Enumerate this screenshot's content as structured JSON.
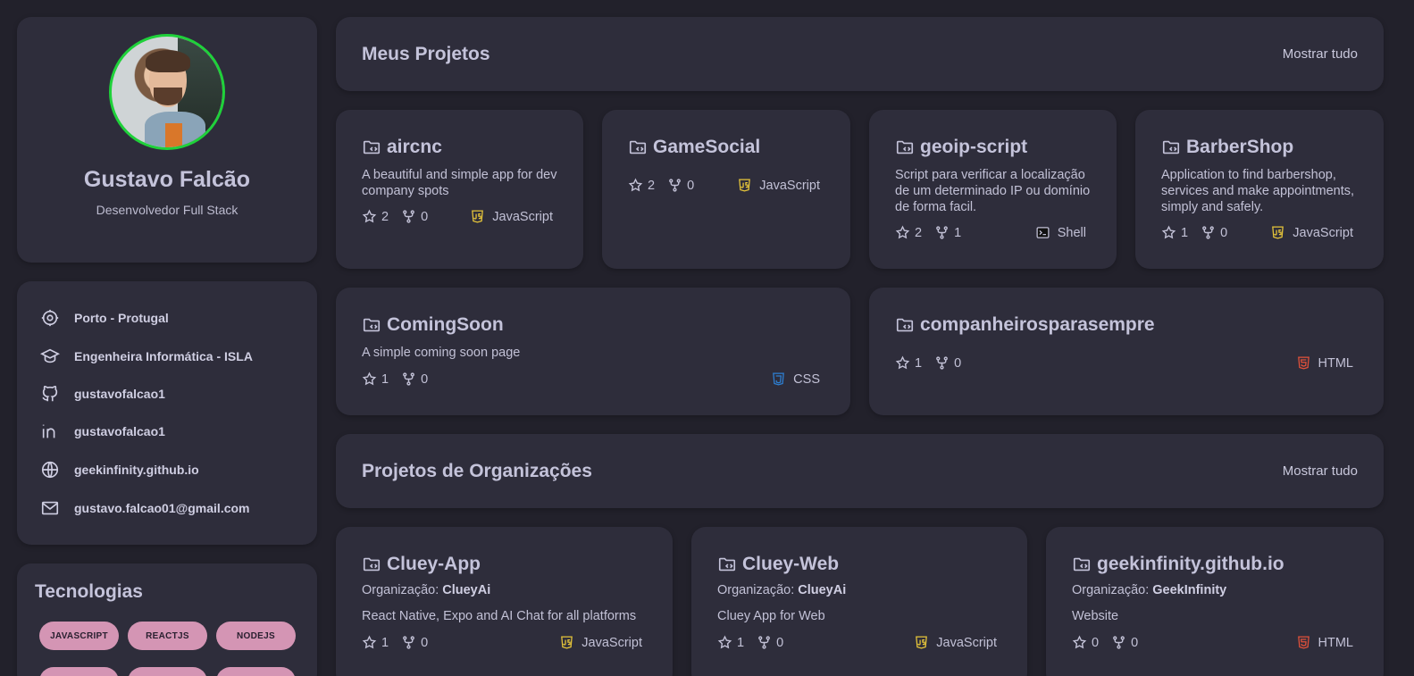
{
  "profile": {
    "name": "Gustavo Falcão",
    "role": "Desenvolvedor Full Stack"
  },
  "info": {
    "location": "Porto - Protugal",
    "education": "Engenheira Informática - ISLA",
    "github": "gustavofalcao1",
    "linkedin": "gustavofalcao1",
    "website": "geekinfinity.github.io",
    "email": "gustavo.falcao01@gmail.com"
  },
  "tech": {
    "title": "Tecnologias",
    "chips": [
      "JAVASCRIPT",
      "REACTJS",
      "NODEJS"
    ]
  },
  "projects": {
    "title": "Meus Projetos",
    "show_all": "Mostrar tudo",
    "items": [
      {
        "name": "aircnc",
        "desc": "A beautiful and simple app for dev company spots",
        "stars": "2",
        "forks": "0",
        "lang": "JavaScript"
      },
      {
        "name": "GameSocial",
        "desc": "",
        "stars": "2",
        "forks": "0",
        "lang": "JavaScript"
      },
      {
        "name": "geoip-script",
        "desc": "Script para verificar a localização de um determinado IP ou domínio de forma facil.",
        "stars": "2",
        "forks": "1",
        "lang": "Shell"
      },
      {
        "name": "BarberShop",
        "desc": "Application to find barbershop, services and make appointments, simply and safely.",
        "stars": "1",
        "forks": "0",
        "lang": "JavaScript"
      },
      {
        "name": "ComingSoon",
        "desc": "A simple coming soon page",
        "stars": "1",
        "forks": "0",
        "lang": "CSS"
      },
      {
        "name": "companheirosparasempre",
        "desc": "",
        "stars": "1",
        "forks": "0",
        "lang": "HTML"
      }
    ]
  },
  "orgs": {
    "title": "Projetos de Organizações",
    "show_all": "Mostrar tudo",
    "org_label": "Organização:",
    "items": [
      {
        "name": "Cluey-App",
        "org": "ClueyAi",
        "desc": "React Native, Expo and AI Chat for all platforms",
        "stars": "1",
        "forks": "0",
        "lang": "JavaScript"
      },
      {
        "name": "Cluey-Web",
        "org": "ClueyAi",
        "desc": "Cluey App for Web",
        "stars": "1",
        "forks": "0",
        "lang": "JavaScript"
      },
      {
        "name": "geekinfinity.github.io",
        "org": "GeekInfinity",
        "desc": "Website",
        "stars": "0",
        "forks": "0",
        "lang": "HTML"
      }
    ]
  },
  "colors": {
    "background": "#22212b",
    "card": "#2e2d3b",
    "avatar_ring": "#1fd13a",
    "chip": "#d495b4",
    "js": "#e6c53a",
    "css": "#2d7fd3",
    "html": "#e2513a"
  }
}
